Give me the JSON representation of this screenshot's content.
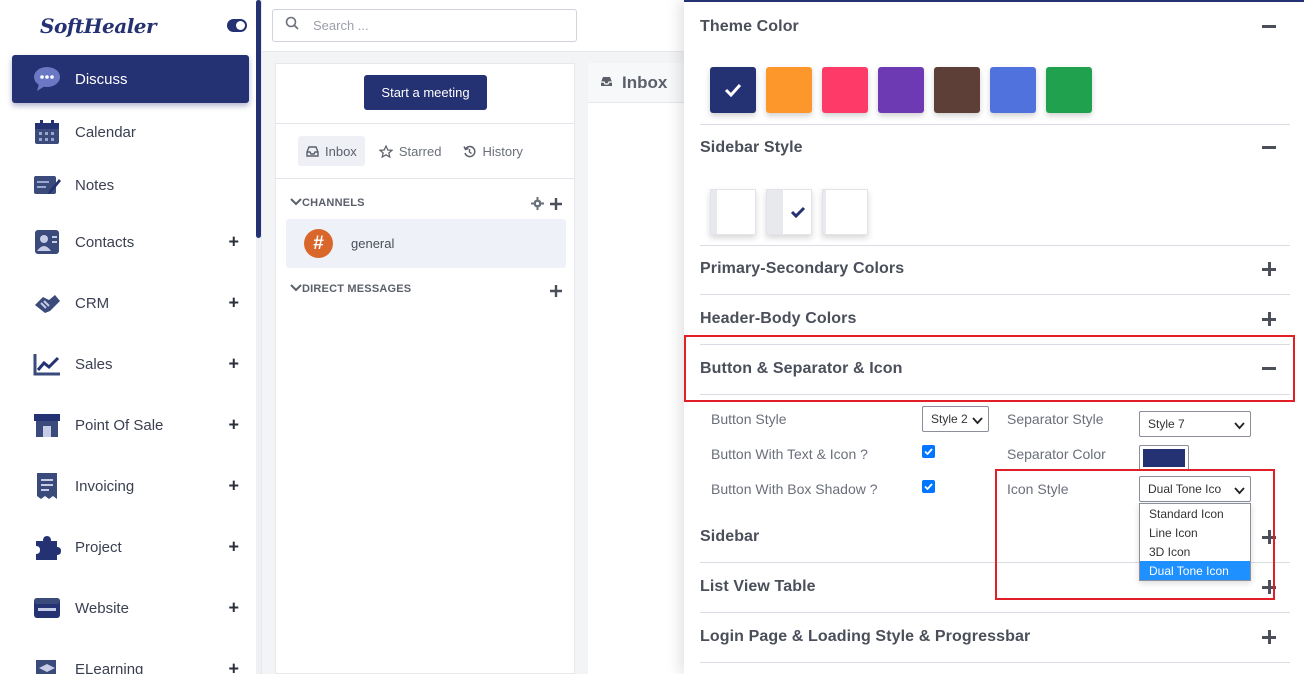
{
  "sidebar": {
    "logo": "SoftHealer",
    "items": [
      {
        "label": "Discuss",
        "icon": "chat-bubble-icon",
        "active": true,
        "expandable": false
      },
      {
        "label": "Calendar",
        "icon": "calendar-icon",
        "active": false,
        "expandable": false
      },
      {
        "label": "Notes",
        "icon": "notes-icon",
        "active": false,
        "expandable": false
      },
      {
        "label": "Contacts",
        "icon": "contacts-icon",
        "active": false,
        "expandable": true
      },
      {
        "label": "CRM",
        "icon": "handshake-icon",
        "active": false,
        "expandable": true
      },
      {
        "label": "Sales",
        "icon": "sales-chart-icon",
        "active": false,
        "expandable": true
      },
      {
        "label": "Point Of Sale",
        "icon": "shop-icon",
        "active": false,
        "expandable": true
      },
      {
        "label": "Invoicing",
        "icon": "invoice-icon",
        "active": false,
        "expandable": true
      },
      {
        "label": "Project",
        "icon": "puzzle-icon",
        "active": false,
        "expandable": true
      },
      {
        "label": "Website",
        "icon": "website-icon",
        "active": false,
        "expandable": true
      },
      {
        "label": "ELearning",
        "icon": "graduation-icon",
        "active": false,
        "expandable": true
      }
    ]
  },
  "search": {
    "placeholder": "Search ..."
  },
  "discuss": {
    "start_meeting": "Start a meeting",
    "tabs": [
      {
        "label": "Inbox",
        "icon": "inbox-icon",
        "active": true
      },
      {
        "label": "Starred",
        "icon": "star-icon",
        "active": false
      },
      {
        "label": "History",
        "icon": "history-icon",
        "active": false
      }
    ],
    "channels_heading": "CHANNELS",
    "channel_name": "general",
    "channel_symbol": "#",
    "direct_messages_heading": "DIRECT MESSAGES",
    "inbox_title": "Inbox"
  },
  "settings": {
    "theme_color_title": "Theme Color",
    "theme_colors": [
      "#243172",
      "#fd962b",
      "#fe3a68",
      "#6e3ab3",
      "#5e3f37",
      "#5072dc",
      "#20a14d"
    ],
    "sidebar_style_title": "Sidebar Style",
    "primary_secondary_title": "Primary-Secondary Colors",
    "header_body_title": "Header-Body Colors",
    "button_separator_title": "Button & Separator & Icon",
    "button_style_label": "Button Style",
    "button_style_value": "Style 2",
    "separator_style_label": "Separator Style",
    "separator_style_value": "Style 7",
    "button_text_icon_label": "Button With Text & Icon ?",
    "separator_color_label": "Separator Color",
    "separator_color": "#243172",
    "button_shadow_label": "Button With Box Shadow ?",
    "icon_style_label": "Icon Style",
    "icon_style_value": "Dual Tone Ico",
    "icon_style_options": [
      "Standard Icon",
      "Line Icon",
      "3D Icon",
      "Dual Tone Icon"
    ],
    "sidebar_title": "Sidebar",
    "list_view_title": "List View Table",
    "login_page_title": "Login Page & Loading Style & Progressbar"
  },
  "colors": {
    "brand": "#243172",
    "highlight_red": "#e01f26",
    "channel_badge": "#d9672b"
  }
}
